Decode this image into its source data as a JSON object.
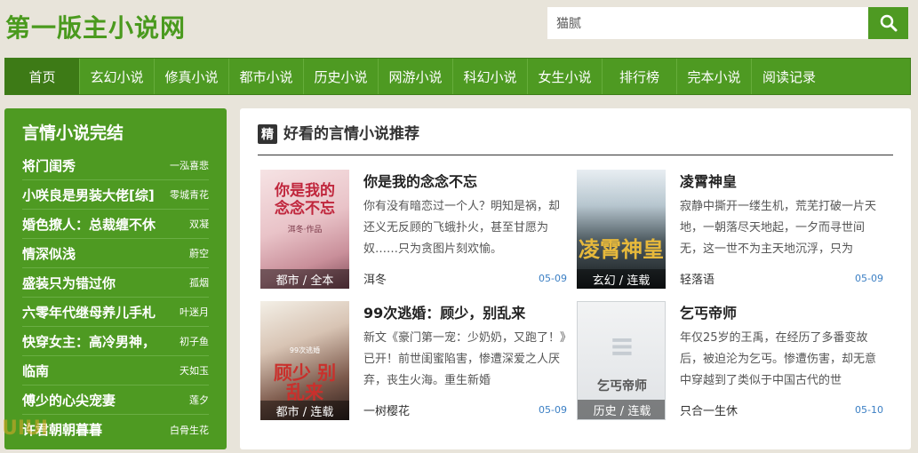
{
  "site": {
    "logo": "第一版主小说网"
  },
  "search": {
    "value": "猫腻"
  },
  "nav": [
    {
      "label": "首页",
      "active": true
    },
    {
      "label": "玄幻小说"
    },
    {
      "label": "修真小说"
    },
    {
      "label": "都市小说"
    },
    {
      "label": "历史小说"
    },
    {
      "label": "网游小说"
    },
    {
      "label": "科幻小说"
    },
    {
      "label": "女生小说"
    },
    {
      "label": "排行榜"
    },
    {
      "label": "完本小说"
    },
    {
      "label": "阅读记录"
    }
  ],
  "sidebar": {
    "title": "言情小说完结",
    "items": [
      {
        "title": "将门闺秀",
        "author": "一泓喜悲"
      },
      {
        "title": "小咲良是男装大佬[综]",
        "author": "零城青花"
      },
      {
        "title": "婚色撩人：总裁缠不休",
        "author": "双凝"
      },
      {
        "title": "情深似浅",
        "author": "蔚空"
      },
      {
        "title": "盛装只为错过你",
        "author": "孤烟"
      },
      {
        "title": "六零年代继母养儿手札",
        "author": "叶迷月"
      },
      {
        "title": "快穿女主：高冷男神，",
        "author": "初子鱼"
      },
      {
        "title": "临南",
        "author": "天如玉"
      },
      {
        "title": "傅少的心尖宠妻",
        "author": "莲夕"
      },
      {
        "title": "许君朝朝暮暮",
        "author": "白骨生花"
      }
    ]
  },
  "main": {
    "badge": "精",
    "title": "好看的言情小说推荐",
    "books": [
      {
        "title": "你是我的念念不忘",
        "desc": "你有没有暗恋过一个人？明知是祸，却还义无反顾的飞蛾扑火，甚至甘愿为奴……只为贪图片刻欢愉。",
        "author": "洱冬",
        "date": "05-09",
        "tag": "都市 / 全本",
        "cover_text": "你是我的念念不忘",
        "cover_sub": "洱冬·作品"
      },
      {
        "title": "凌霄神皇",
        "desc": "寂静中撕开一缕生机，荒芜打破一片天地，一朝落尽天地起，一夕而寻世间无，这一世不为主天地沉浮，只为",
        "author": "轻落语",
        "date": "05-09",
        "tag": "玄幻 / 连载",
        "cover_text": "凌霄神皇"
      },
      {
        "title": "99次逃婚：顾少，别乱来",
        "desc": "新文《豪门第一宠：少奶奶，又跑了！》已开！前世闺蜜陷害，惨遭深爱之人厌弃，丧生火海。重生新婚",
        "author": "一树樱花",
        "date": "05-09",
        "tag": "都市 / 连载",
        "cover_text": "顾少 别乱来",
        "cover_sub": "99次逃婚"
      },
      {
        "title": "乞丐帝师",
        "desc": "年仅25岁的王禹，在经历了多番变故后，被迫沦为乞丐。惨遭伤害，却无意中穿越到了类似于中国古代的世",
        "author": "只合一生休",
        "date": "05-10",
        "tag": "历史 / 连载",
        "cover_text": "乞丐帝师"
      }
    ]
  },
  "colors": {
    "brand": "#4e9a22",
    "page_bg": "#e8e4da",
    "date": "#3b7fc4"
  }
}
